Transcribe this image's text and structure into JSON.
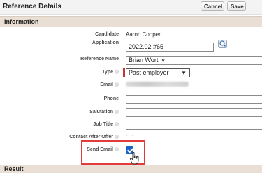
{
  "header": {
    "title": "Reference Details",
    "cancel_label": "Cancel",
    "save_label": "Save"
  },
  "sections": {
    "information": "Information",
    "result": "Result"
  },
  "fields": {
    "candidate": {
      "label": "Candidate",
      "value": "Aaron Cooper"
    },
    "application": {
      "label": "Application",
      "value": "2022.02 #65"
    },
    "reference_name": {
      "label": "Reference Name",
      "value": "Brian Worthy"
    },
    "type": {
      "label": "Type",
      "value": "Past employer"
    },
    "email": {
      "label": "Email",
      "value": ""
    },
    "phone": {
      "label": "Phone",
      "value": ""
    },
    "salutation": {
      "label": "Salutation",
      "value": ""
    },
    "job_title": {
      "label": "Job Title",
      "value": ""
    },
    "contact_after_offer": {
      "label": "Contact After Offer",
      "checked": false
    },
    "send_email": {
      "label": "Send Email",
      "checked": true
    }
  },
  "colors": {
    "section_bar": "#eadfd5",
    "required_marker": "#c23934",
    "highlight": "#e23b3b",
    "checkbox_checked": "#1a62c8"
  },
  "icons": {
    "lookup": "magnifier-lookup-icon",
    "help": "help-icon",
    "cursor": "pointer-cursor-icon"
  }
}
